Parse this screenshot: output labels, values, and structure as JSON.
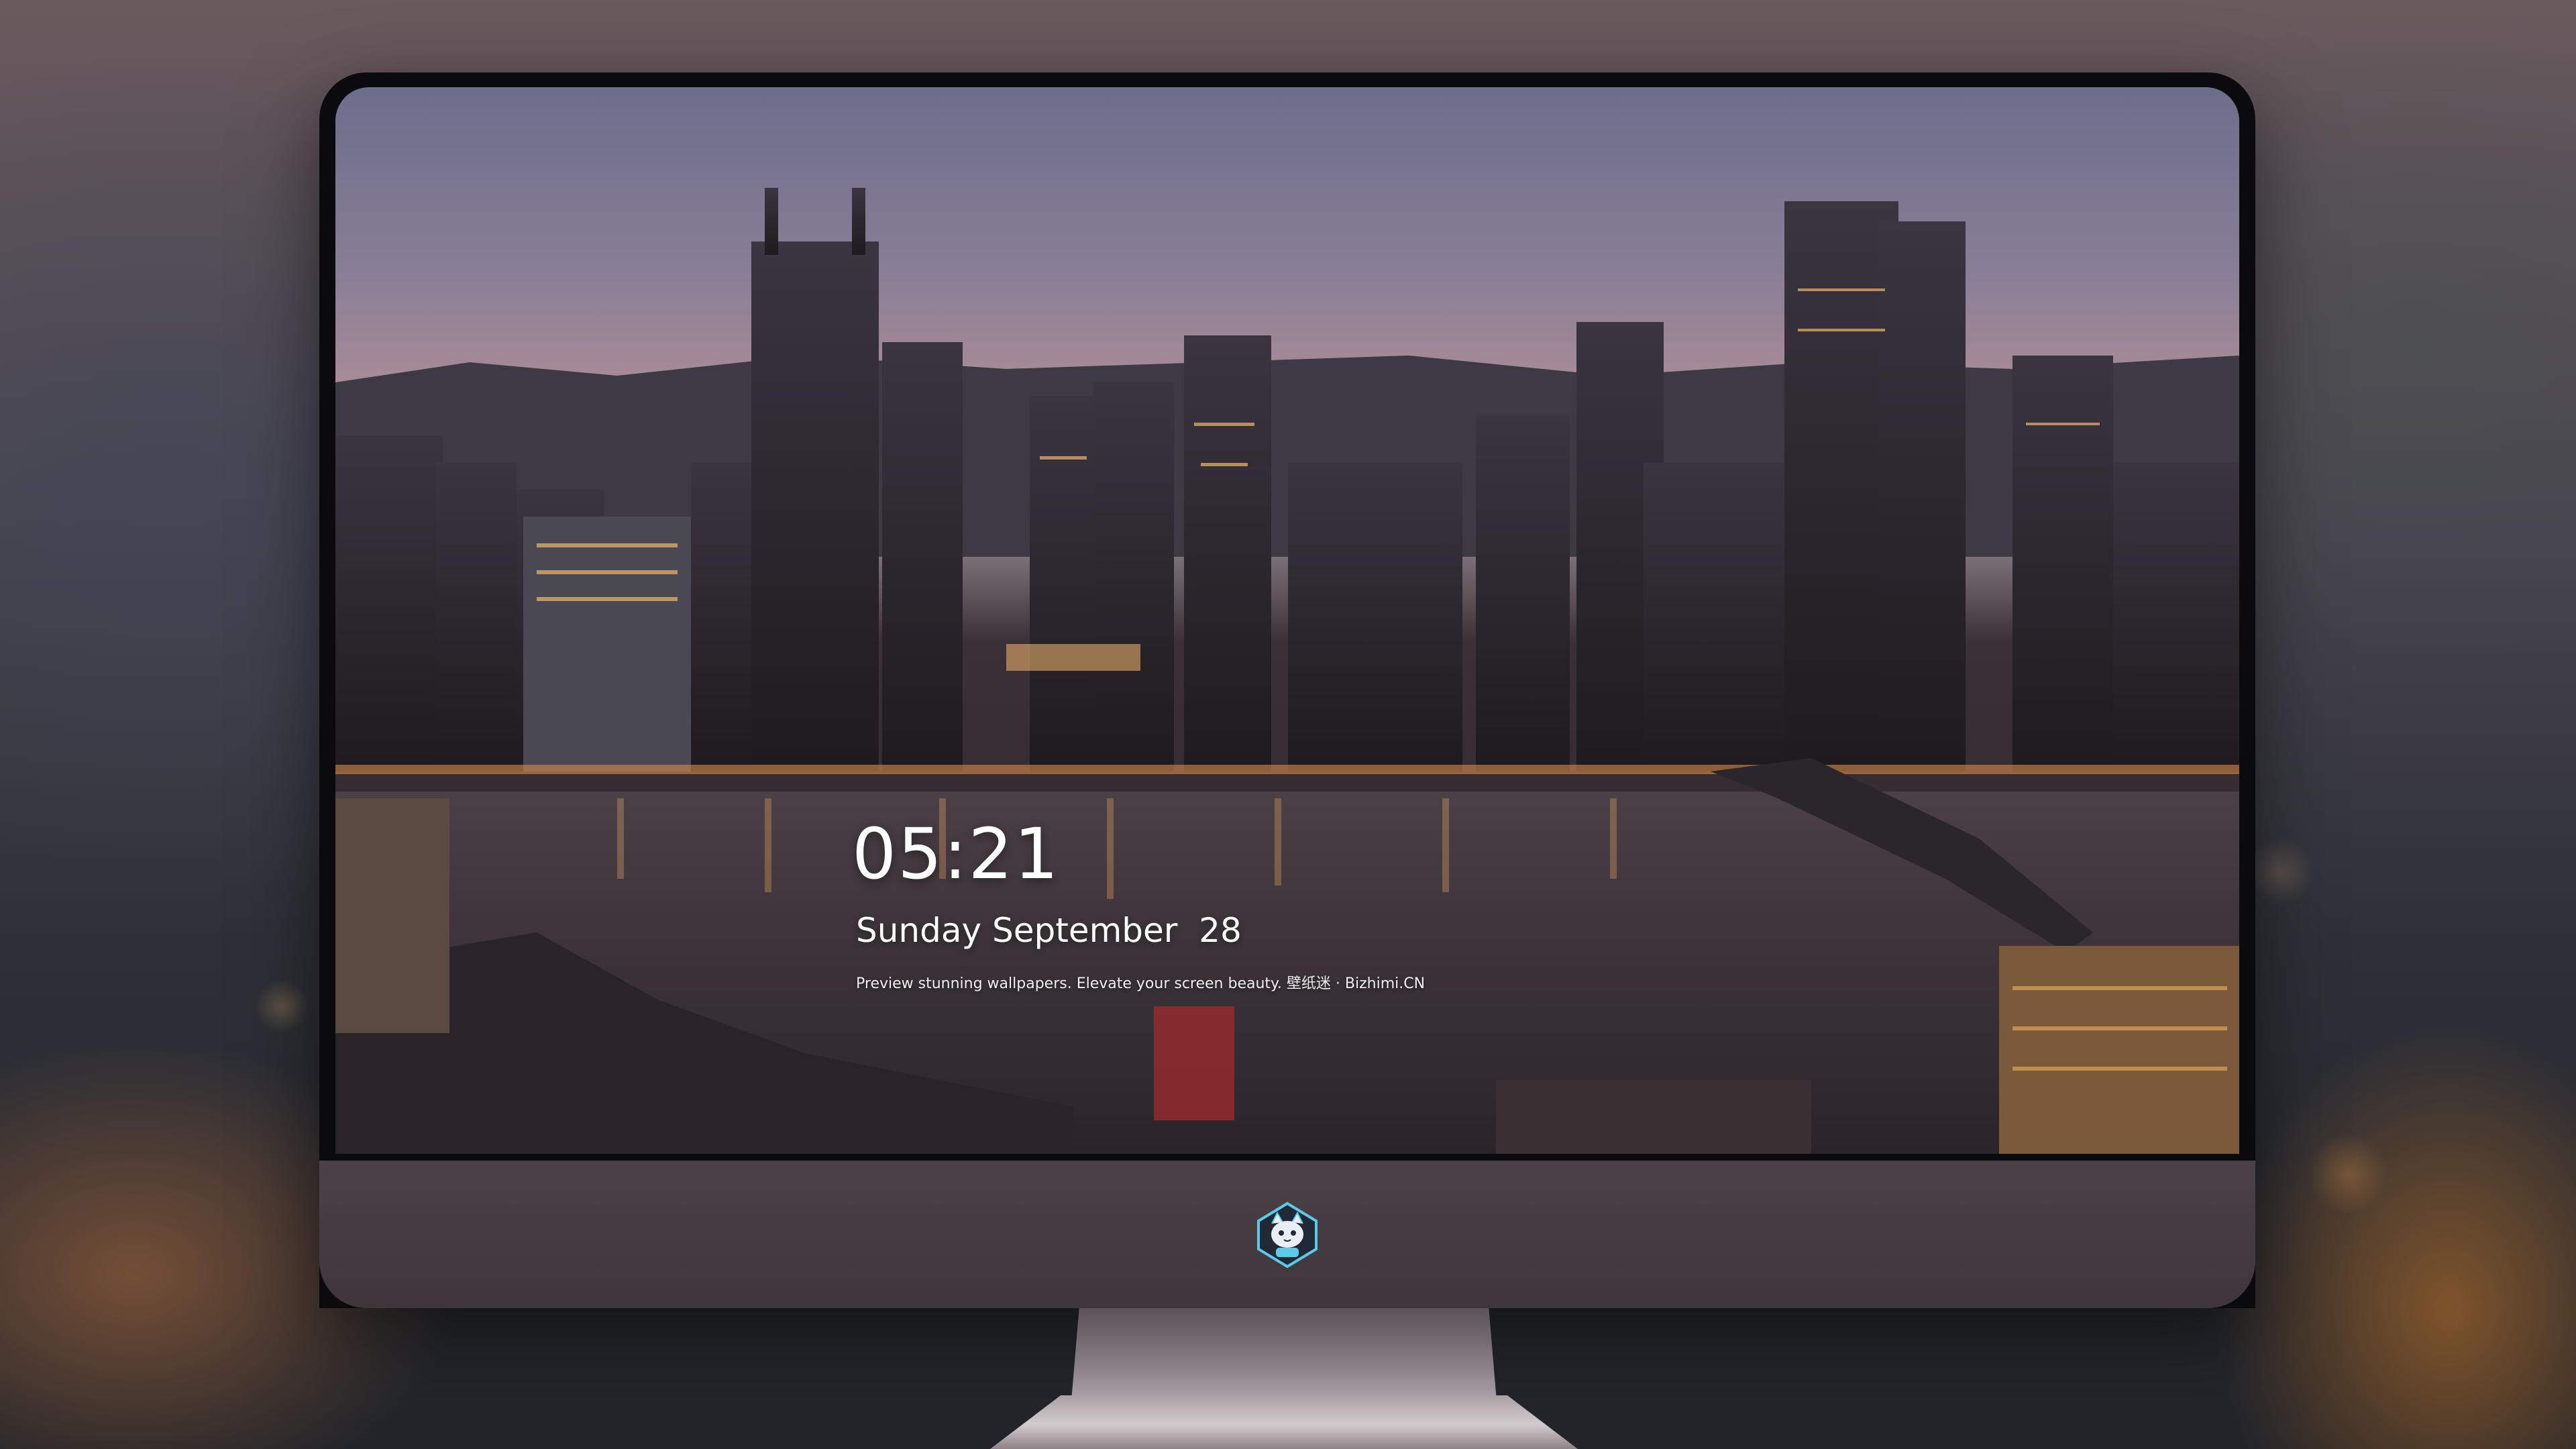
{
  "lock_screen": {
    "time": "05:21",
    "date": "Sunday September  28",
    "tagline": "Preview stunning wallpapers. Elevate your screen beauty. 壁纸迷 · Bizhimi.CN"
  },
  "dock": {
    "apps": [
      {
        "icon": "messages-icon",
        "color": "#34c759"
      },
      {
        "icon": "weather-icon",
        "color": "#2f8cf0"
      },
      {
        "icon": "clock-icon",
        "color": "#f2f2f2"
      },
      {
        "icon": "preview-icon",
        "color": "#e8e8ea"
      },
      {
        "icon": "clips-icon",
        "color": "#39b5e8"
      },
      {
        "icon": "notes-icon",
        "color": "#ffd64a"
      },
      {
        "icon": "photo-booth-icon",
        "color": "#e0e0e0"
      },
      {
        "icon": "music-icon",
        "color": "#f24fa8"
      },
      {
        "icon": "app-store-icon",
        "color": "#1e90ff"
      },
      {
        "icon": "camera-icon",
        "color": "#4a4a4e"
      }
    ]
  },
  "chin": {
    "logo": "cat-mascot-logo-icon"
  }
}
